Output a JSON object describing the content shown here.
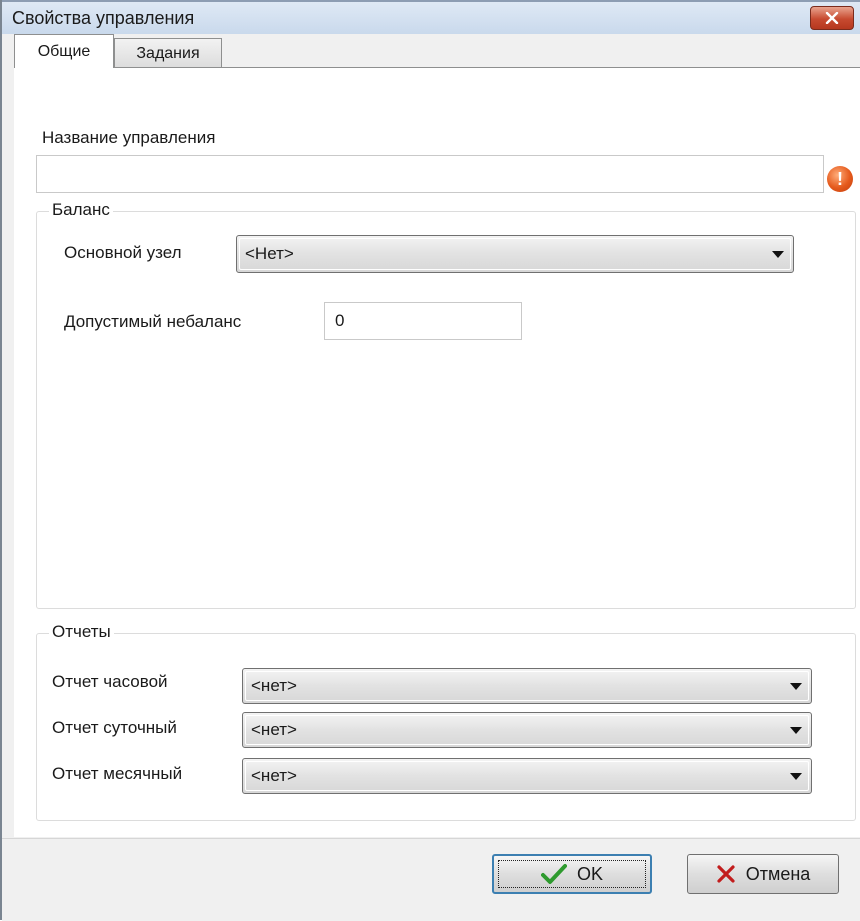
{
  "window": {
    "title": "Свойства управления",
    "close_icon": "close-icon"
  },
  "tabs": [
    {
      "label": "Общие",
      "selected": true
    },
    {
      "label": "Задания",
      "selected": false
    }
  ],
  "general": {
    "name_label": "Название управления",
    "name_value": "",
    "name_warning_icon": "exclamation-icon",
    "balance": {
      "legend": "Баланс",
      "main_node_label": "Основной узел",
      "main_node_value": "<Нет>",
      "imbalance_label": "Допустимый небаланс",
      "imbalance_value": "0"
    },
    "reports": {
      "legend": "Отчеты",
      "hourly_label": "Отчет часовой",
      "hourly_value": "<нет>",
      "daily_label": "Отчет суточный",
      "daily_value": "<нет>",
      "monthly_label": "Отчет месячный",
      "monthly_value": "<нет>"
    }
  },
  "buttons": {
    "ok_label": "OK",
    "cancel_label": "Отмена"
  },
  "colors": {
    "close_button": "#c74a30",
    "warning_icon": "#e55a1c",
    "ok_check": "#2e9a2e",
    "cancel_x": "#c21d1d",
    "focus_border": "#3c7fb1"
  }
}
